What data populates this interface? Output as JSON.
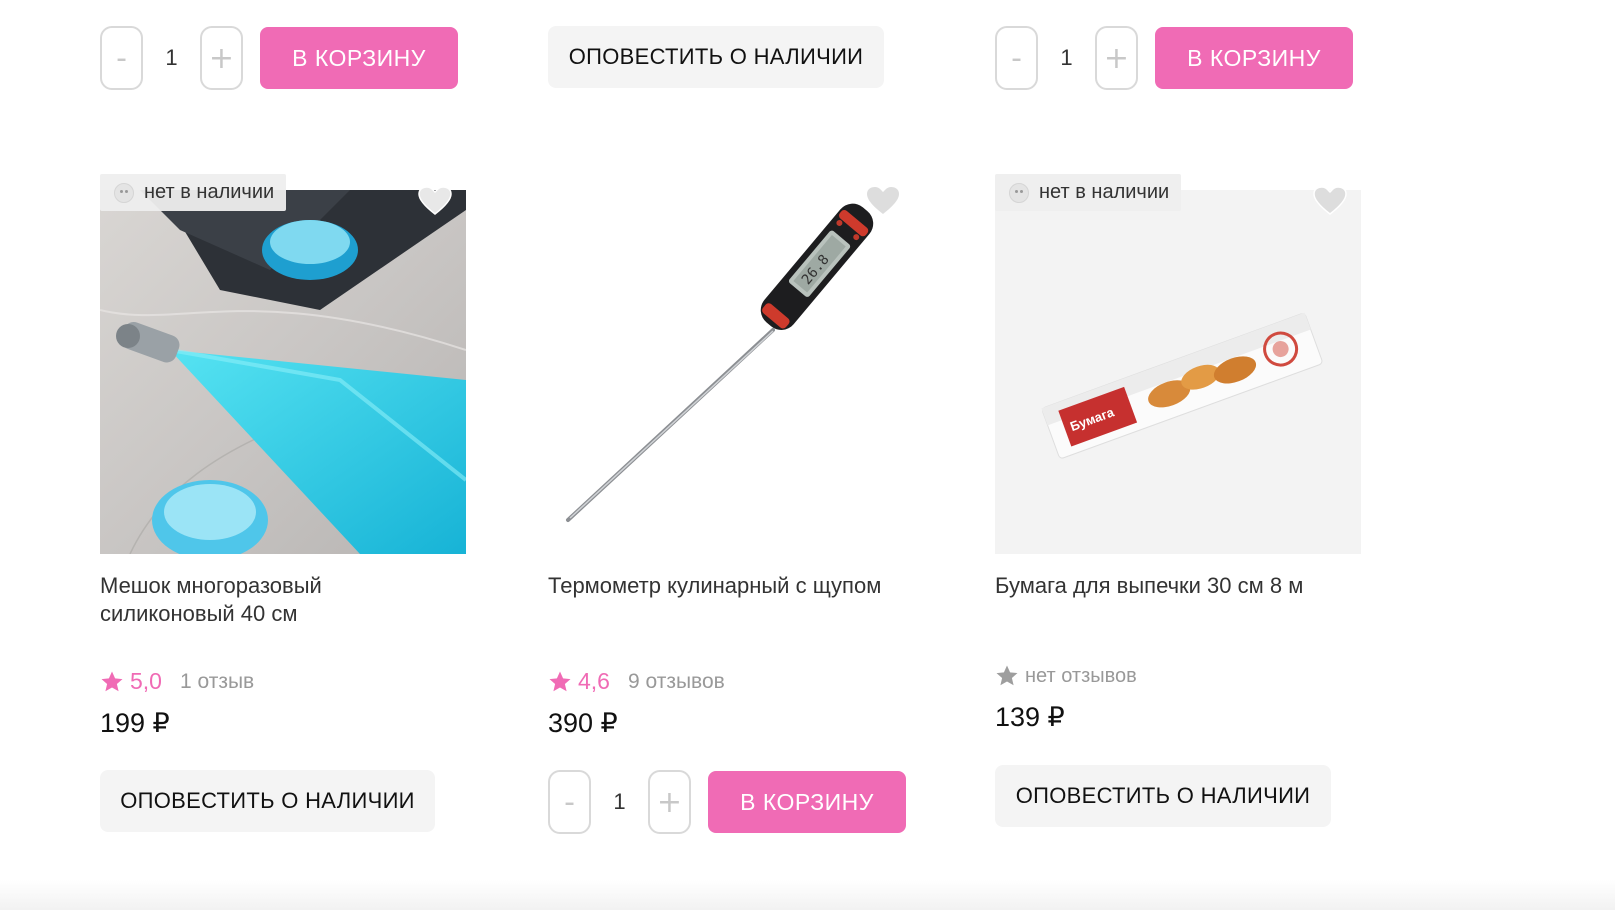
{
  "top_row": {
    "col1": {
      "minus": "-",
      "qty": "1",
      "plus": "+",
      "cart_label": "В КОРЗИНУ"
    },
    "col2": {
      "notify_label": "ОПОВЕСТИТЬ О НАЛИЧИИ"
    },
    "col3": {
      "minus": "-",
      "qty": "1",
      "plus": "+",
      "cart_label": "В КОРЗИНУ"
    }
  },
  "products": [
    {
      "badge": "нет в наличии",
      "title": "Мешок многоразовый силиконовый 40 см",
      "rating": "5,0",
      "reviews": "1 отзыв",
      "price": "199 ₽",
      "action": {
        "notify_label": "ОПОВЕСТИТЬ О НАЛИЧИИ"
      },
      "image": "piping-bag-photo"
    },
    {
      "title": "Термометр кулинарный с щупом",
      "rating": "4,6",
      "reviews": "9 отзывов",
      "price": "390 ₽",
      "action": {
        "minus": "-",
        "qty": "1",
        "plus": "+",
        "cart_label": "В КОРЗИНУ"
      },
      "image": "thermometer-photo"
    },
    {
      "badge": "нет в наличии",
      "title": "Бумага для выпечки 30 см 8 м",
      "reviews": "нет отзывов",
      "price": "139 ₽",
      "action": {
        "notify_label": "ОПОВЕСТИТЬ О НАЛИЧИИ"
      },
      "image": "baking-paper-photo",
      "image_text": "Бумага"
    }
  ],
  "colors": {
    "accent": "#f06bb5",
    "notify_bg": "#f4f4f4",
    "star_inactive": "#9e9e9e"
  }
}
